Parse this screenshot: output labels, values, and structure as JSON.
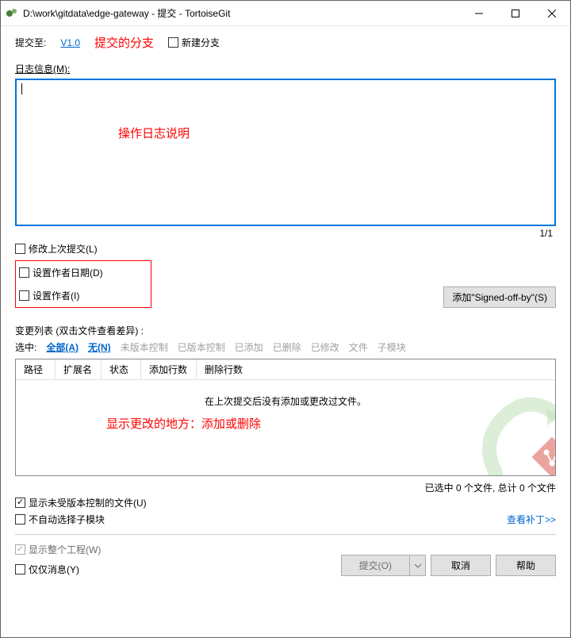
{
  "title": "D:\\work\\gitdata\\edge-gateway - 提交 - TortoiseGit",
  "topRow": {
    "commitTo": "提交至:",
    "branch": "V1.0",
    "annoBranch": "提交的分支",
    "newBranch": "新建分支"
  },
  "logMsg": {
    "label": "日志信息(M):",
    "anno": "操作日志说明",
    "counter": "1/1",
    "amend": "修改上次提交(L)",
    "setDate": "设置作者日期(D)",
    "setAuthor": "设置作者(I)",
    "signedBtn": "添加\"Signed-off-by\"(S)"
  },
  "changes": {
    "title": "变更列表 (双击文件查看差异) :",
    "selLabel": "选中:",
    "fAll": "全部(A)",
    "fNone": "无(N)",
    "fUnver": "未版本控制",
    "fVer": "已版本控制",
    "fAdded": "已添加",
    "fDel": "已删除",
    "fMod": "已修改",
    "fFile": "文件",
    "fSub": "子模块",
    "cols": {
      "path": "路径",
      "ext": "扩展名",
      "status": "状态",
      "addLines": "添加行数",
      "delLines": "删除行数"
    },
    "empty": "在上次提交后没有添加或更改过文件。",
    "anno": "显示更改的地方：添加或删除",
    "summary": "已选中 0 个文件, 总计 0 个文件",
    "showUnver": "显示未受版本控制的文件(U)",
    "noAutoSub": "不自动选择子模块",
    "viewPatch": "查看补丁>>",
    "showWhole": "显示整个工程(W)",
    "onlyMsg": "仅仅消息(Y)"
  },
  "footer": {
    "commit": "提交(O)",
    "cancel": "取消",
    "help": "帮助"
  }
}
